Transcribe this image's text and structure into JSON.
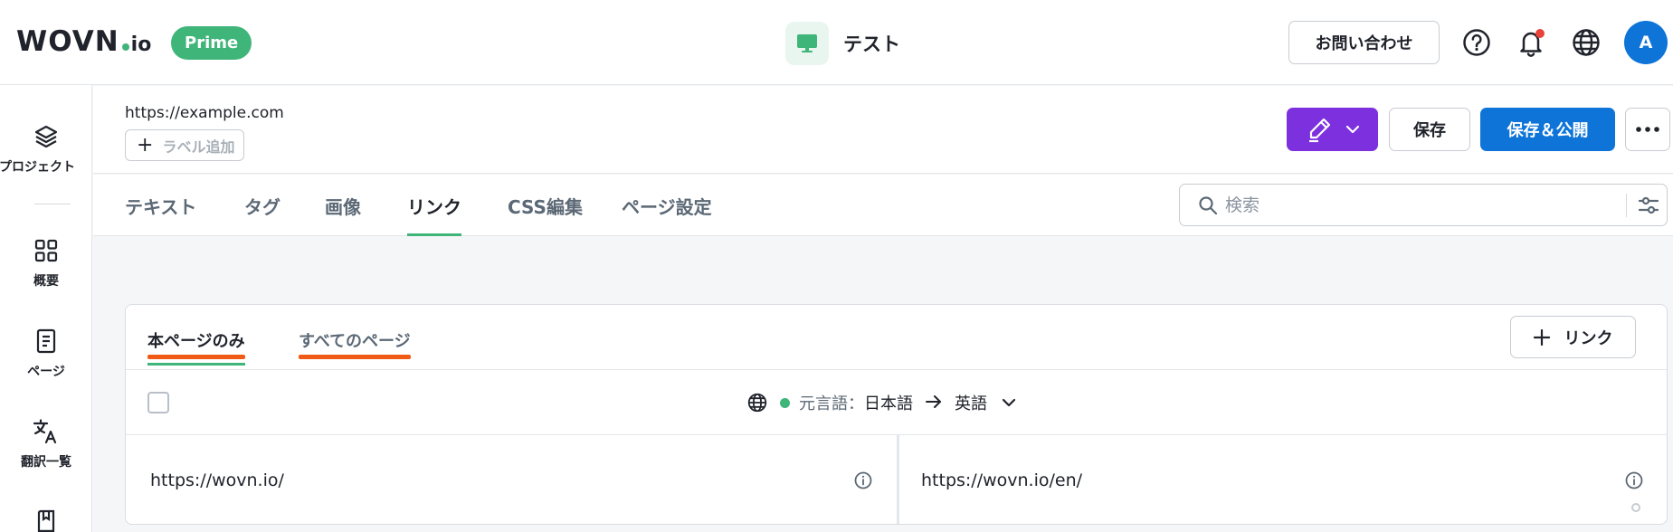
{
  "header": {
    "logo_main": "WOVN",
    "logo_suffix": "io",
    "plan_badge": "Prime",
    "project_name": "テスト",
    "contact_label": "お問い合わせ",
    "avatar_initial": "A",
    "icons": [
      "help-icon",
      "bell-icon",
      "globe-icon"
    ],
    "notification_dot_color": "#e8433a"
  },
  "sidebar": {
    "items": [
      {
        "label": "プロジェクト",
        "icon": "layers-icon"
      },
      {
        "label": "概要",
        "icon": "grid-icon"
      },
      {
        "label": "ページ",
        "icon": "document-icon"
      },
      {
        "label": "翻訳一覧",
        "icon": "translate-icon"
      },
      {
        "label": "",
        "icon": "book-icon"
      }
    ]
  },
  "page": {
    "url": "https://example.com",
    "add_label": "ラベル追加",
    "save_label": "保存",
    "publish_label": "保存＆公開"
  },
  "tabs": [
    {
      "label": "テキスト",
      "active": false
    },
    {
      "label": "タグ",
      "active": false
    },
    {
      "label": "画像",
      "active": false
    },
    {
      "label": "リンク",
      "active": true
    },
    {
      "label": "CSS編集",
      "active": false
    },
    {
      "label": "ページ設定",
      "active": false
    }
  ],
  "search": {
    "placeholder": "検索"
  },
  "links_panel": {
    "scope_tabs": [
      {
        "label": "本ページのみ",
        "active": true
      },
      {
        "label": "すべてのページ",
        "active": false
      }
    ],
    "add_link_label": "リンク",
    "source_label": "元言語",
    "source_language": "日本語",
    "target_language": "英語",
    "rows": [
      {
        "source": "https://wovn.io/",
        "target": "https://wovn.io/en/"
      }
    ]
  },
  "colors": {
    "brand_green": "#40b57a",
    "edit_purple": "#7d30de",
    "primary_blue": "#0e74d8",
    "annotation_orange": "#f05a14"
  }
}
